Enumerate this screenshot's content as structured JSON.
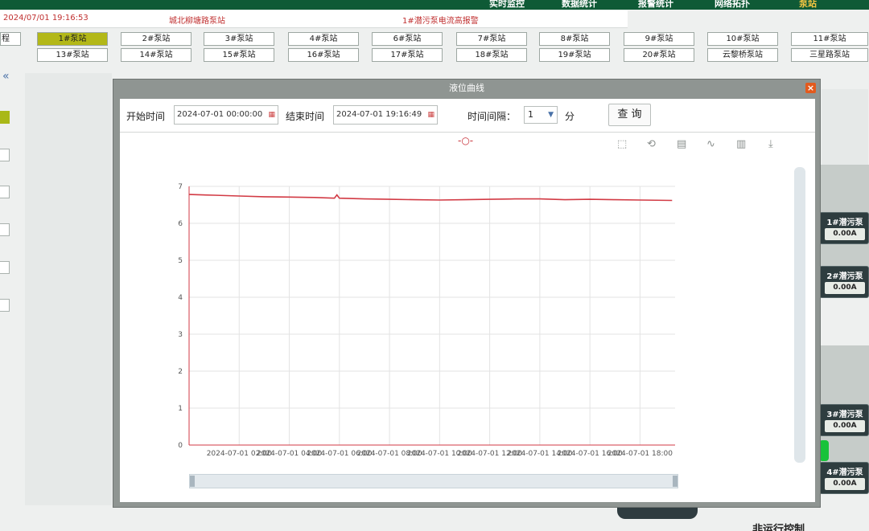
{
  "nav": {
    "items": [
      "实时监控",
      "数据统计",
      "报警统计",
      "网络拓扑",
      "泵站"
    ],
    "active_index": 4
  },
  "alarm_bar": {
    "datetime": "2024/07/01 19:16:53",
    "location": "城北柳塘路泵站",
    "message": "1#潜污泵电流高报警"
  },
  "left_partial_label": "程",
  "stations_row1": [
    "1#泵站",
    "2#泵站",
    "3#泵站",
    "4#泵站",
    "6#泵站",
    "7#泵站",
    "8#泵站",
    "9#泵站",
    "10#泵站",
    "11#泵站"
  ],
  "stations_row2": [
    "13#泵站",
    "14#泵站",
    "15#泵站",
    "16#泵站",
    "17#泵站",
    "18#泵站",
    "19#泵站",
    "20#泵站",
    "云黎桥泵站",
    "三星路泵站"
  ],
  "active_station": "1#泵站",
  "collapse_icon": "«",
  "pumps": [
    {
      "name": "1#潜污泵",
      "value": "0.00A"
    },
    {
      "name": "2#潜污泵",
      "value": "0.00A"
    },
    {
      "name": "3#潜污泵",
      "value": "0.00A"
    },
    {
      "name": "4#潜污泵",
      "value": "0.00A"
    }
  ],
  "bottom_partial_label": "非运行控制",
  "dialog": {
    "title": "液位曲线",
    "close_glyph": "×",
    "start_label": "开始时间",
    "start_value": "2024-07-01 00:00:00",
    "end_label": "结束时间",
    "end_value": "2024-07-01 19:16:49",
    "interval_label": "时间间隔：",
    "interval_value": "1",
    "interval_unit": "分",
    "query_label": "查 询",
    "toolbox_icons": [
      "zoom-icon",
      "zoom-reset-icon",
      "data-view-icon",
      "line-chart-icon",
      "bar-chart-icon",
      "download-icon"
    ]
  },
  "chart_data": {
    "type": "line",
    "title": "",
    "xlabel": "",
    "ylabel": "",
    "ylim": [
      0,
      7
    ],
    "yticks": [
      0,
      1,
      2,
      3,
      4,
      5,
      6,
      7
    ],
    "x_tick_labels": [
      "2024-07-01 02:00",
      "2024-07-01 04:00",
      "2024-07-01 06:00",
      "2024-07-01 08:00",
      "2024-07-01 10:00",
      "2024-07-01 12:00",
      "2024-07-01 14:00",
      "2024-07-01 16:00",
      "2024-07-01 18:00"
    ],
    "x_hours": [
      0,
      1,
      2,
      3,
      4,
      5,
      5.8,
      5.9,
      6.0,
      7,
      8,
      9,
      10,
      11,
      12,
      13,
      14,
      15,
      16,
      17,
      18,
      19.28
    ],
    "values": [
      6.78,
      6.76,
      6.74,
      6.72,
      6.71,
      6.7,
      6.68,
      6.77,
      6.68,
      6.66,
      6.65,
      6.64,
      6.63,
      6.64,
      6.65,
      6.66,
      6.66,
      6.64,
      6.65,
      6.64,
      6.63,
      6.62
    ],
    "series_color": "#d23a44",
    "grid": true
  }
}
